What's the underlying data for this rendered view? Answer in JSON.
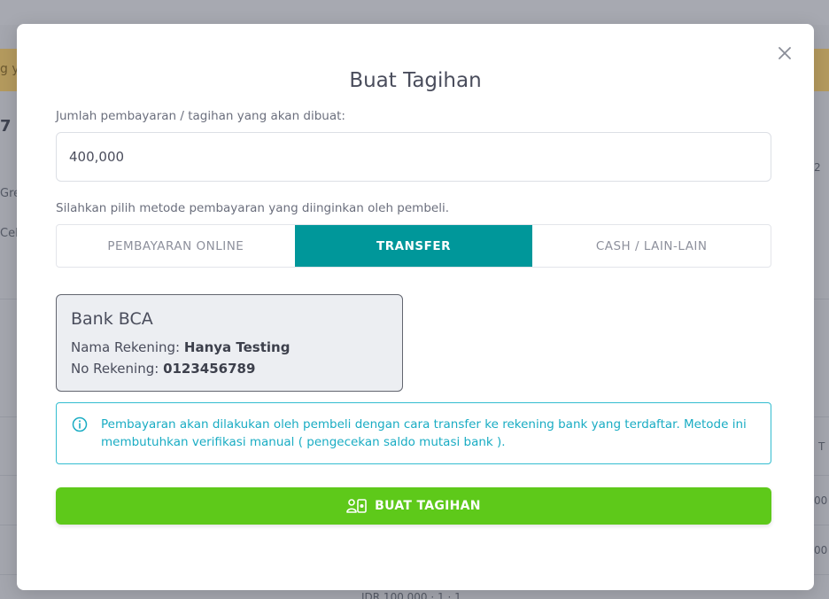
{
  "background": {
    "strip_text": "g y",
    "number": "7",
    "side_text_1": "Gre",
    "side_text_2": "Cel",
    "right_text_1": "2",
    "right_text_2": "T",
    "right_text_3": "00",
    "right_text_4": "00",
    "bottom_text": "IDR 100.000 · 1 · 1"
  },
  "modal": {
    "title": "Buat Tagihan",
    "close_icon": "close-icon",
    "amount_label": "Jumlah pembayaran / tagihan yang akan dibuat:",
    "amount_value": "400,000",
    "method_label": "Silahkan pilih metode pembayaran yang diinginkan oleh pembeli.",
    "tabs": [
      {
        "label": "PEMBAYARAN ONLINE",
        "active": false
      },
      {
        "label": "TRANSFER",
        "active": true
      },
      {
        "label": "CASH / LAIN-LAIN",
        "active": false
      }
    ],
    "bank": {
      "name": "Bank BCA",
      "account_name_label": "Nama Rekening:",
      "account_name": "Hanya Testing",
      "account_no_label": "No Rekening:",
      "account_no": "0123456789"
    },
    "info": {
      "icon": "info-icon",
      "text": "Pembayaran akan dilakukan oleh pembeli dengan cara transfer ke rekening bank yang terdaftar. Metode ini membutuhkan verifikasi manual ( pengecekan saldo mutasi bank )."
    },
    "submit": {
      "icon": "create-invoice-icon",
      "label": "BUAT TAGIHAN"
    }
  },
  "colors": {
    "accent": "#00979a",
    "success": "#5ec91a",
    "info": "#19acc3"
  }
}
